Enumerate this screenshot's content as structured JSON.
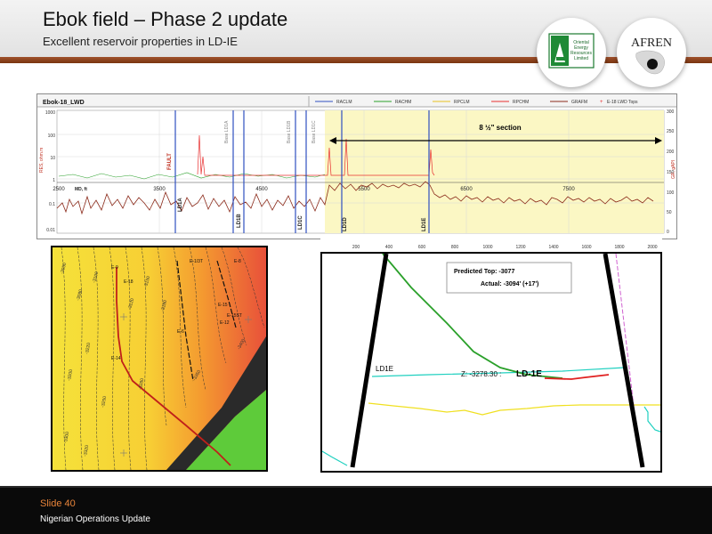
{
  "header": {
    "title": "Ebok field – Phase 2 update",
    "subtitle": "Excellent reservoir properties in LD-IE"
  },
  "logos": {
    "left": {
      "name": "Oriental Energy Resources Limited",
      "lines": [
        "Oriental",
        "Energy",
        "Resources",
        "Limited"
      ]
    },
    "right": {
      "name": "AFREN"
    }
  },
  "log_panel": {
    "well_name": "Ebok-18_LWD",
    "legend": [
      "RACLM",
      "RACHM",
      "RPCLM",
      "RPCHM",
      "GRAFM",
      "E-18 LWD Tops"
    ],
    "section_label": "8 ½\" section",
    "left_axis_label": "RES, ohm.m",
    "right_axis_label": "GR, gAPI",
    "md_label": "MD, ft",
    "md_ticks": [
      "2500",
      "3500",
      "4500",
      "5500",
      "6500",
      "7500"
    ],
    "left_ticks": [
      "1000",
      "100",
      "10",
      "1",
      "0.1",
      "0.01"
    ],
    "right_ticks": [
      "300",
      "250",
      "200",
      "150",
      "100",
      "50",
      "0"
    ],
    "markers": [
      "FAULT",
      "LD1A",
      "LD1B",
      "LD1C",
      "LD1D",
      "LD1E"
    ],
    "base_markers": [
      "Base LD1A",
      "Base LD1B",
      "Base LD1C"
    ],
    "colors": {
      "racl": "#3050c0",
      "rach": "#2aa02a",
      "rpcl": "#e8c020",
      "rpch": "#e83030",
      "graf": "#8b2a1a",
      "highlight": "#fbf7c4"
    }
  },
  "map_panel": {
    "contour_labels": [
      "-3050",
      "-3080",
      "-3100",
      "-3120",
      "-3150",
      "-3180",
      "-3200",
      "-3220",
      "-3250",
      "-3280",
      "-3300",
      "-3320",
      "-3350",
      "-3400"
    ],
    "well_labels": [
      "E-9",
      "E-1/3T",
      "E-8",
      "E-18",
      "E-15",
      "E-15ST",
      "E-6",
      "E-12",
      "E-14"
    ],
    "colors": {
      "yellow": "#f5e23a",
      "orange": "#f49a30",
      "red": "#e8503a",
      "green": "#5ecb3a",
      "fault": "#2a2a2a",
      "trajectory": "#c0201a"
    }
  },
  "section_panel": {
    "x_ticks": [
      "200",
      "400",
      "600",
      "800",
      "1000",
      "1200",
      "1400",
      "1600",
      "1800",
      "2000"
    ],
    "predicted_top": "Predicted Top: -3077",
    "actual": "Actual: -3094' (+17')",
    "z_label": "Z: -3278.30 :",
    "ld_label_bold": "LD-1E",
    "ld_label_left": "LD1E",
    "colors": {
      "green": "#2aa02a",
      "cyan": "#20d0c0",
      "yellow": "#f0e020",
      "red": "#e02020",
      "magenta": "#d060d0",
      "fault": "#000000"
    }
  },
  "footer": {
    "slide_number": "Slide 40",
    "text": "Nigerian Operations Update"
  }
}
